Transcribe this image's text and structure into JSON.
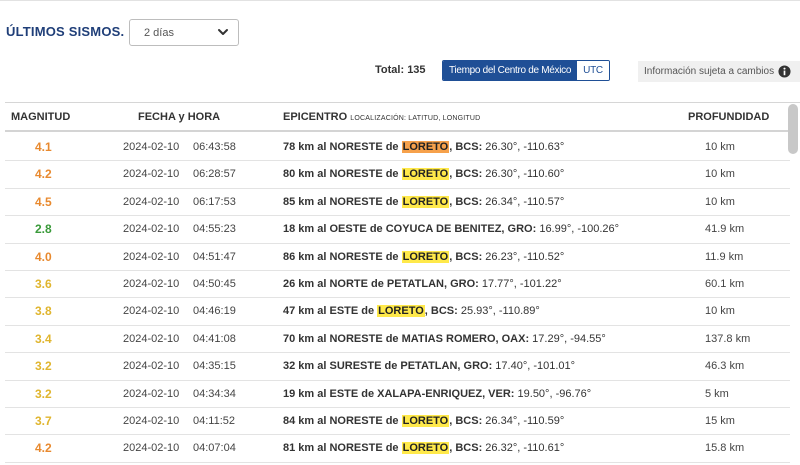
{
  "header": {
    "title": "ÚLTIMOS SISMOS.",
    "range_select": {
      "value": "2 días"
    }
  },
  "toolbar": {
    "total_label": "Total:",
    "total_value": "135",
    "tz_options": [
      "Tiempo del Centro de México",
      "UTC"
    ],
    "info_text": "Información sujeta a cambios"
  },
  "table": {
    "columns": {
      "magnitud": "MAGNITUD",
      "fecha": "FECHA y HORA",
      "epicentro": "EPICENTRO",
      "epicentro_sub": "LOCALIZACIÓN: LATITUD, LONGITUD",
      "profundidad": "PROFUNDIDAD"
    },
    "rows": [
      {
        "mag": "4.1",
        "date": "2024-02-10",
        "time": "06:43:58",
        "pre": "78 km al NORESTE de ",
        "hl": "LORETO",
        "post": ", BCS:",
        "coords": " 26.30°, -110.63°",
        "prof": "10 km",
        "magColor": "#e8892e",
        "hlColor": "#f6a14b"
      },
      {
        "mag": "4.2",
        "date": "2024-02-10",
        "time": "06:28:57",
        "pre": "80 km al NORESTE de ",
        "hl": "LORETO",
        "post": ", BCS:",
        "coords": " 26.30°, -110.60°",
        "prof": "10 km",
        "magColor": "#e8892e",
        "hlColor": "#ffe94a"
      },
      {
        "mag": "4.5",
        "date": "2024-02-10",
        "time": "06:17:53",
        "pre": "85 km al NORESTE de ",
        "hl": "LORETO",
        "post": ", BCS:",
        "coords": " 26.34°, -110.57°",
        "prof": "10 km",
        "magColor": "#e8892e",
        "hlColor": "#ffe94a"
      },
      {
        "mag": "2.8",
        "date": "2024-02-10",
        "time": "04:55:23",
        "pre": "18 km al OESTE de COYUCA DE BENITEZ, GRO:",
        "hl": "",
        "post": "",
        "coords": " 16.99°, -100.26°",
        "prof": "41.9 km",
        "magColor": "#3a9a3a",
        "hlColor": ""
      },
      {
        "mag": "4.0",
        "date": "2024-02-10",
        "time": "04:51:47",
        "pre": "86 km al NORESTE de ",
        "hl": "LORETO",
        "post": ", BCS:",
        "coords": " 26.23°, -110.52°",
        "prof": "11.9 km",
        "magColor": "#e8892e",
        "hlColor": "#ffe94a"
      },
      {
        "mag": "3.6",
        "date": "2024-02-10",
        "time": "04:50:45",
        "pre": "26 km al NORTE de PETATLAN, GRO:",
        "hl": "",
        "post": "",
        "coords": " 17.77°, -101.22°",
        "prof": "60.1 km",
        "magColor": "#e0b52e",
        "hlColor": ""
      },
      {
        "mag": "3.8",
        "date": "2024-02-10",
        "time": "04:46:19",
        "pre": "47 km al ESTE de ",
        "hl": "LORETO",
        "post": ", BCS:",
        "coords": " 25.93°, -110.89°",
        "prof": "10 km",
        "magColor": "#e0b52e",
        "hlColor": "#ffe94a"
      },
      {
        "mag": "3.4",
        "date": "2024-02-10",
        "time": "04:41:08",
        "pre": "70 km al NORESTE de MATIAS ROMERO, OAX:",
        "hl": "",
        "post": "",
        "coords": " 17.29°, -94.55°",
        "prof": "137.8 km",
        "magColor": "#e0b52e",
        "hlColor": ""
      },
      {
        "mag": "3.2",
        "date": "2024-02-10",
        "time": "04:35:15",
        "pre": "32 km al SURESTE de PETATLAN, GRO:",
        "hl": "",
        "post": "",
        "coords": " 17.40°, -101.01°",
        "prof": "46.3 km",
        "magColor": "#e0b52e",
        "hlColor": ""
      },
      {
        "mag": "3.2",
        "date": "2024-02-10",
        "time": "04:34:34",
        "pre": "19 km al ESTE de XALAPA-ENRIQUEZ, VER:",
        "hl": "",
        "post": "",
        "coords": " 19.50°, -96.76°",
        "prof": "5 km",
        "magColor": "#e0b52e",
        "hlColor": ""
      },
      {
        "mag": "3.7",
        "date": "2024-02-10",
        "time": "04:11:52",
        "pre": "84 km al NORESTE de ",
        "hl": "LORETO",
        "post": ", BCS:",
        "coords": " 26.34°, -110.59°",
        "prof": "15 km",
        "magColor": "#e0b52e",
        "hlColor": "#ffe94a"
      },
      {
        "mag": "4.2",
        "date": "2024-02-10",
        "time": "04:07:04",
        "pre": "81 km al NORESTE de ",
        "hl": "LORETO",
        "post": ", BCS:",
        "coords": " 26.32°, -110.61°",
        "prof": "15.8 km",
        "magColor": "#e8892e",
        "hlColor": "#ffe94a"
      }
    ]
  },
  "icons": {
    "dropdown": "chevron-down-icon",
    "info": "info-circle-icon"
  },
  "colors": {
    "brand": "#1f3e78",
    "tz_active": "#1f4f96"
  }
}
